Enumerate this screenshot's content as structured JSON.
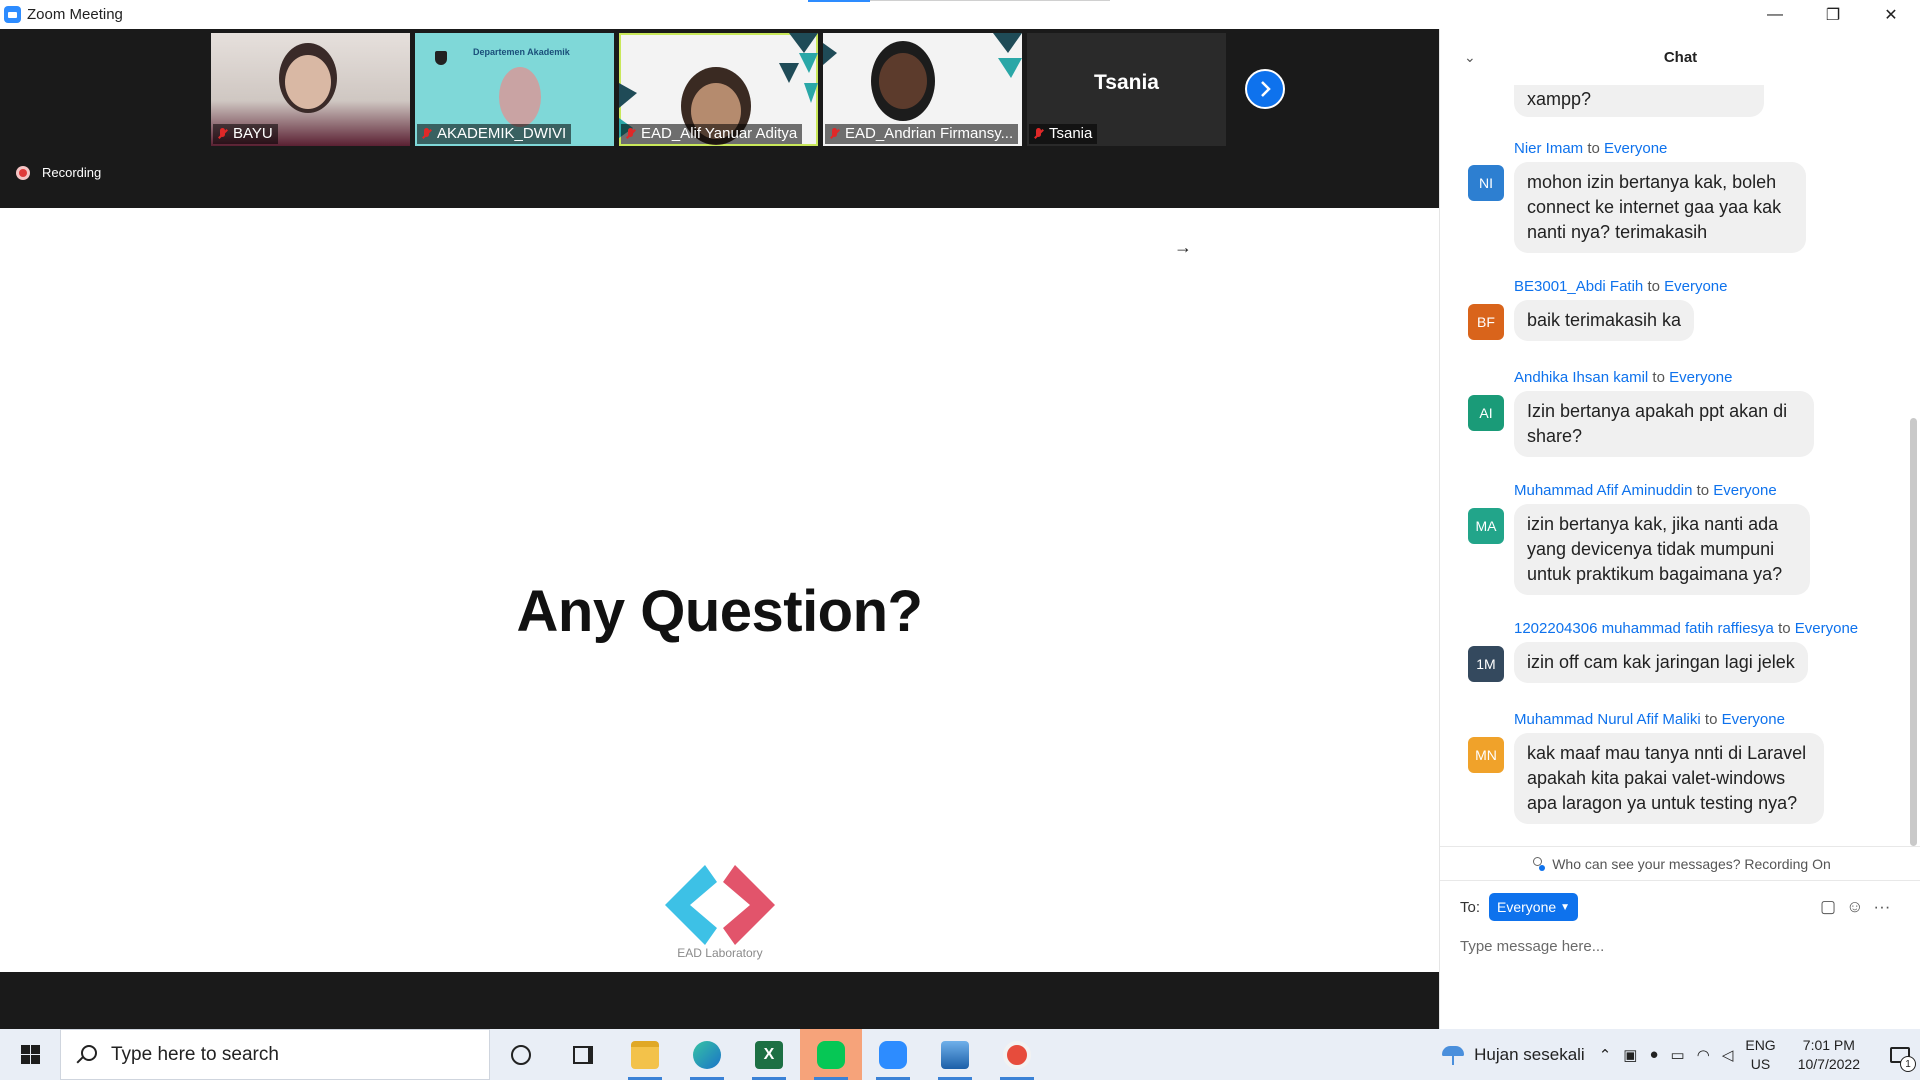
{
  "window": {
    "title": "Zoom Meeting",
    "controls": {
      "minimize": "—",
      "restore": "❐",
      "close": "✕"
    }
  },
  "participants": [
    {
      "name": "BAYU",
      "muted": true
    },
    {
      "name": "AKADEMIK_DWIVI",
      "muted": true,
      "banner": "Departemen Akademik"
    },
    {
      "name": "EAD_Alif Yanuar Aditya",
      "muted": true,
      "active_speaker": true
    },
    {
      "name": "EAD_Andrian Firmansy...",
      "muted": true
    },
    {
      "name": "Tsania",
      "muted": true,
      "display_text": "Tsania"
    }
  ],
  "recording": {
    "label": "Recording"
  },
  "slide": {
    "headline": "Any Question?",
    "logo_caption": "EAD Laboratory"
  },
  "chat": {
    "title": "Chat",
    "partial_message": "xampp?",
    "messages": [
      {
        "sender": "Nier Imam",
        "to": "to",
        "recipient": "Everyone",
        "initials": "NI",
        "avatar_color": "#2d7fd1",
        "text": "mohon izin bertanya kak, boleh connect ke internet gaa yaa kak nanti nya? terimakasih"
      },
      {
        "sender": "BE3001_Abdi Fatih",
        "to": "to",
        "recipient": "Everyone",
        "initials": "BF",
        "avatar_color": "#d9641b",
        "text": "baik terimakasih ka"
      },
      {
        "sender": "Andhika Ihsan kamil",
        "to": "to",
        "recipient": "Everyone",
        "initials": "AI",
        "avatar_color": "#1a9b78",
        "text": "Izin bertanya apakah ppt akan di share?"
      },
      {
        "sender": "Muhammad Afif Aminuddin",
        "to": "to",
        "recipient": "Everyone",
        "initials": "MA",
        "avatar_color": "#22a58a",
        "text": "izin bertanya kak, jika nanti ada yang devicenya tidak mumpuni untuk praktikum bagaimana ya?"
      },
      {
        "sender": "1202204306 muhammad fatih raffiesya",
        "to": "to",
        "recipient": "Everyone",
        "initials": "1M",
        "avatar_color": "#34495e",
        "text": "izin off cam kak jaringan lagi jelek"
      },
      {
        "sender": "Muhammad Nurul Afif Maliki",
        "to": "to",
        "recipient": "Everyone",
        "initials": "MN",
        "avatar_color": "#f0a22a",
        "text": "kak maaf mau tanya nnti di Laravel apakah kita pakai valet-windows apa laragon ya untuk testing nya?"
      }
    ],
    "notice": "Who can see your messages? Recording On",
    "to_label": "To:",
    "to_value": "Everyone",
    "input_placeholder": "Type message here...",
    "more_label": "···"
  },
  "taskbar": {
    "search_placeholder": "Type here to search",
    "apps": [
      "cortana-icon",
      "task-view-icon",
      "file-explorer-icon",
      "edge-icon",
      "excel-icon",
      "line-icon",
      "zoom-icon",
      "photos-icon",
      "snipping-icon"
    ],
    "weather": "Hujan sesekali",
    "language_top": "ENG",
    "language_bottom": "US",
    "time": "7:01 PM",
    "date": "10/7/2022",
    "notification_count": "1"
  },
  "colors": {
    "accent": "#0e72ed",
    "recording": "#e03a3a",
    "active_speaker_border": "#c9e85a"
  }
}
